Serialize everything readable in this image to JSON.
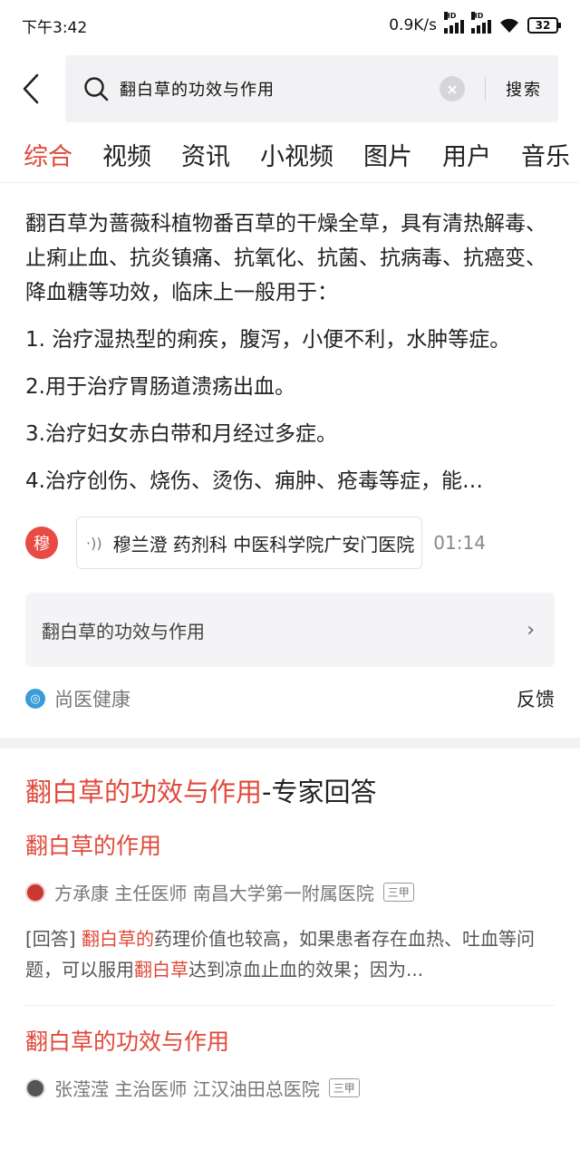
{
  "status_bar": {
    "time": "下午3:42",
    "network_speed": "0.9K/s",
    "signal_badge": "HD",
    "battery": "32"
  },
  "search": {
    "query": "翻白草的功效与作用",
    "button": "搜索"
  },
  "tabs": [
    {
      "label": "综合",
      "active": true
    },
    {
      "label": "视频",
      "active": false
    },
    {
      "label": "资讯",
      "active": false
    },
    {
      "label": "小视频",
      "active": false
    },
    {
      "label": "图片",
      "active": false
    },
    {
      "label": "用户",
      "active": false
    },
    {
      "label": "音乐",
      "active": false
    }
  ],
  "answer": {
    "intro": "翻百草为蔷薇科植物番百草的干燥全草，具有清热解毒、止痢止血、抗炎镇痛、抗氧化、抗菌、抗病毒、抗癌变、降血糖等功效，临床上一般用于：",
    "items": [
      "1. 治疗湿热型的痢疾，腹泻，小便不利，水肿等症。",
      "2.用于治疗胃肠道溃疡出血。",
      "3.治疗妇女赤白带和月经过多症。",
      "4.治疗创伤、烧伤、烫伤、痈肿、疮毒等症，能…"
    ],
    "author_avatar_char": "穆",
    "author_info": "穆兰澄 药剂科 中医科学院广安门医院",
    "audio_duration": "01:14",
    "related_query": "翻白草的功效与作用",
    "source": "尚医健康",
    "feedback": "反馈"
  },
  "expert": {
    "title_highlight": "翻白草的功效与作用",
    "title_suffix": "-专家回答",
    "items": [
      {
        "title": "翻白草的作用",
        "doctor": "方承康 主任医师 南昌大学第一附属医院",
        "badge": "三甲",
        "tag": "[回答]",
        "kw1": "翻白草的",
        "text1": "药理价值也较高，如果患者存在血热、吐血等问题，可以服用",
        "kw2": "翻白草",
        "text2": "达到凉血止血的效果；因为..."
      },
      {
        "title": "翻白草的功效与作用",
        "doctor": "张滢滢 主治医师 江汉油田总医院",
        "badge": "三甲"
      }
    ]
  },
  "colors": {
    "accent": "#e0493b",
    "search_bg": "#f2f2f4",
    "related_bg": "#f4f4f6",
    "source_icon": "#3a9bd9"
  },
  "icons": {
    "back": "back-arrow-icon",
    "search": "search-icon",
    "clear": "clear-icon",
    "audio": "audio-wave-icon",
    "chevron": "chevron-right-icon",
    "source": "shangyi-logo-icon"
  }
}
